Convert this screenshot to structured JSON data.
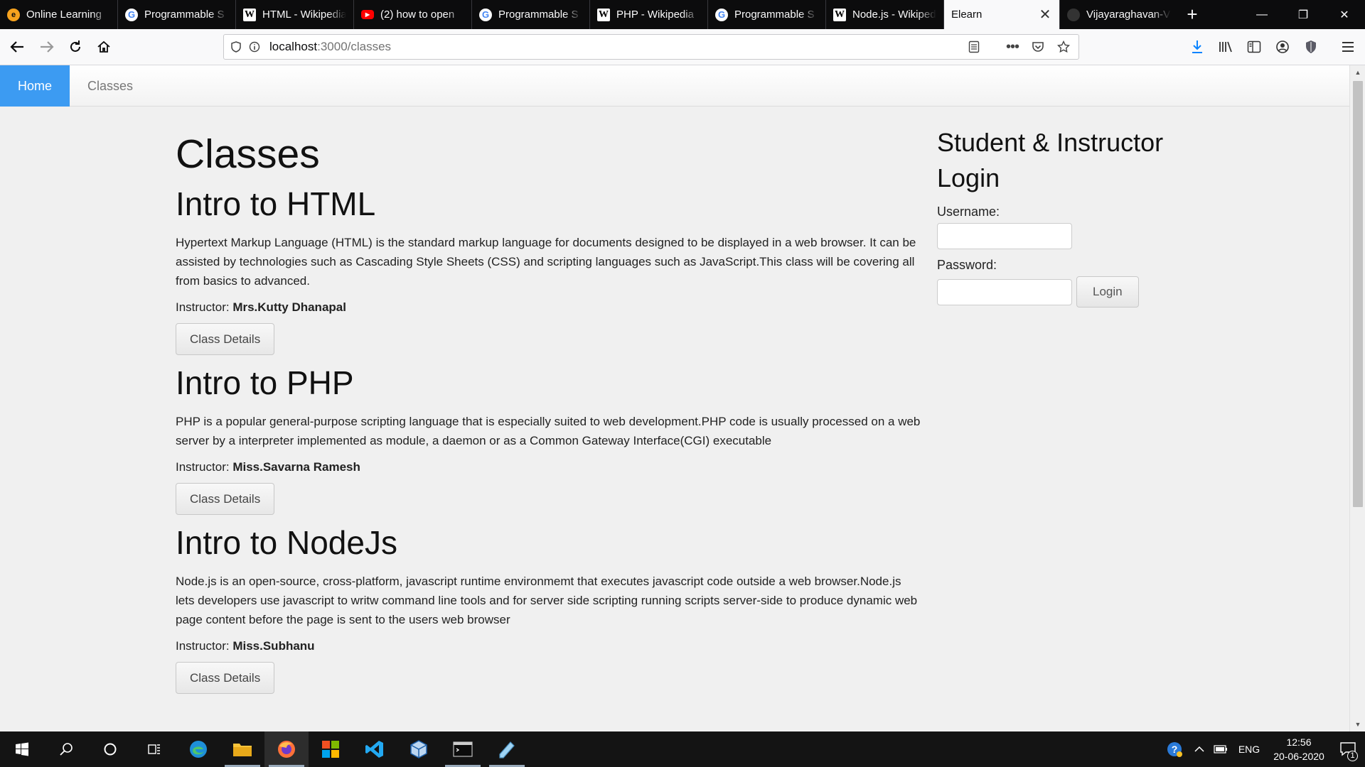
{
  "browser": {
    "tabs": [
      {
        "title": "Online Learning",
        "icon": "edge-icon",
        "glyph": "e",
        "active": false
      },
      {
        "title": "Programmable S",
        "icon": "google-icon",
        "glyph": "G",
        "active": false
      },
      {
        "title": "HTML - Wikipedia",
        "icon": "wikipedia-icon",
        "glyph": "W",
        "active": false
      },
      {
        "title": "(2) how to open",
        "icon": "youtube-icon",
        "glyph": "▶",
        "active": false
      },
      {
        "title": "Programmable S",
        "icon": "google-icon",
        "glyph": "G",
        "active": false
      },
      {
        "title": "PHP - Wikipedia",
        "icon": "wikipedia-icon",
        "glyph": "W",
        "active": false
      },
      {
        "title": "Programmable S",
        "icon": "google-icon",
        "glyph": "G",
        "active": false
      },
      {
        "title": "Node.js - Wikipedia",
        "icon": "wikipedia-icon",
        "glyph": "W",
        "active": false
      },
      {
        "title": "Elearn",
        "icon": "",
        "glyph": "",
        "active": true
      },
      {
        "title": "Vijayaraghavan-V",
        "icon": "github-icon",
        "glyph": "",
        "active": false
      }
    ],
    "new_tab_glyph": "+",
    "window_controls": {
      "minimize": "—",
      "restore": "❐",
      "close": "✕"
    },
    "url_host": "localhost",
    "url_path": ":3000/classes"
  },
  "site": {
    "nav": {
      "home": "Home",
      "classes": "Classes"
    },
    "page_title": "Classes",
    "classes": [
      {
        "title": "Intro to HTML",
        "description": "Hypertext Markup Language (HTML) is the standard markup language for documents designed to be displayed in a web browser. It can be assisted by technologies such as Cascading Style Sheets (CSS) and scripting languages such as JavaScript.This class will be covering all from basics to advanced.",
        "instructor_label": "Instructor:",
        "instructor": "Mrs.Kutty Dhanapal",
        "button": "Class Details"
      },
      {
        "title": "Intro to PHP",
        "description": "PHP is a popular general-purpose scripting language that is especially suited to web development.PHP code is usually processed on a web server by a interpreter implemented as module, a daemon or as a Common Gateway Interface(CGI) executable",
        "instructor_label": "Instructor:",
        "instructor": "Miss.Savarna Ramesh",
        "button": "Class Details"
      },
      {
        "title": "Intro to NodeJs",
        "description": "Node.js is an open-source, cross-platform, javascript runtime environmemt that executes javascript code outside a web browser.Node.js lets developers use javascript to writw command line tools and for server side scripting running scripts server-side to produce dynamic web page content before the page is sent to the users web browser",
        "instructor_label": "Instructor:",
        "instructor": "Miss.Subhanu",
        "button": "Class Details"
      }
    ],
    "login": {
      "title": "Student & Instructor Login",
      "username_label": "Username:",
      "username_value": "",
      "password_label": "Password:",
      "password_value": "",
      "button": "Login"
    }
  },
  "taskbar": {
    "apps": [
      "windows-start-icon",
      "search-icon",
      "cortana-icon",
      "task-view-icon",
      "edge-icon",
      "file-explorer-icon",
      "firefox-icon",
      "office-icon",
      "vscode-icon",
      "virtualbox-icon",
      "terminal-icon",
      "notepad-icon"
    ],
    "language": "ENG",
    "time": "12:56",
    "date": "20-06-2020",
    "notification_count": "1"
  }
}
